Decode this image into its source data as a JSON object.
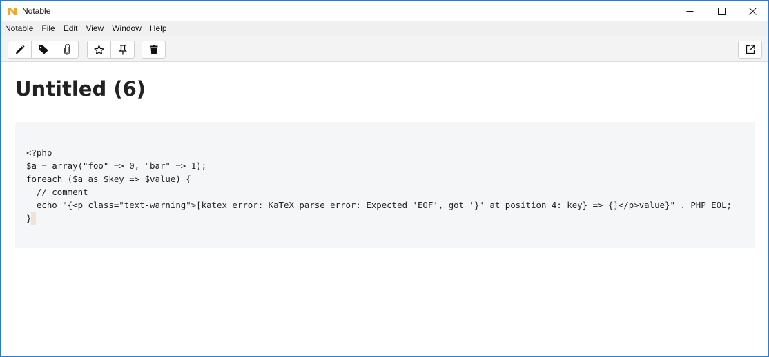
{
  "window": {
    "title": "Notable",
    "logo_icon": "notable-logo-icon"
  },
  "menu": [
    "Notable",
    "File",
    "Edit",
    "View",
    "Window",
    "Help"
  ],
  "toolbar": {
    "group1": [
      "pencil-icon",
      "tag-icon",
      "paperclip-icon"
    ],
    "group2": [
      "star-icon",
      "pin-icon"
    ],
    "group3": [
      "trash-icon"
    ],
    "right": [
      "open-external-icon"
    ]
  },
  "note": {
    "title": "Untitled (6)",
    "code_lines": [
      "<?php",
      "$a = array(\"foo\" => 0, \"bar\" => 1);",
      "foreach ($a as $key => $value) {",
      "  // comment",
      "  echo \"{<p class=\"text-warning\">[katex error: KaTeX parse error: Expected 'EOF', got '}' at position 4: key}_=> {]</p>value}\" . PHP_EOL;",
      "}"
    ]
  },
  "colors": {
    "window_border": "#2b7bd2",
    "logo": "#f5a623",
    "code_background": "#f5f6f7",
    "toolbar_background": "#f3f3f4"
  }
}
